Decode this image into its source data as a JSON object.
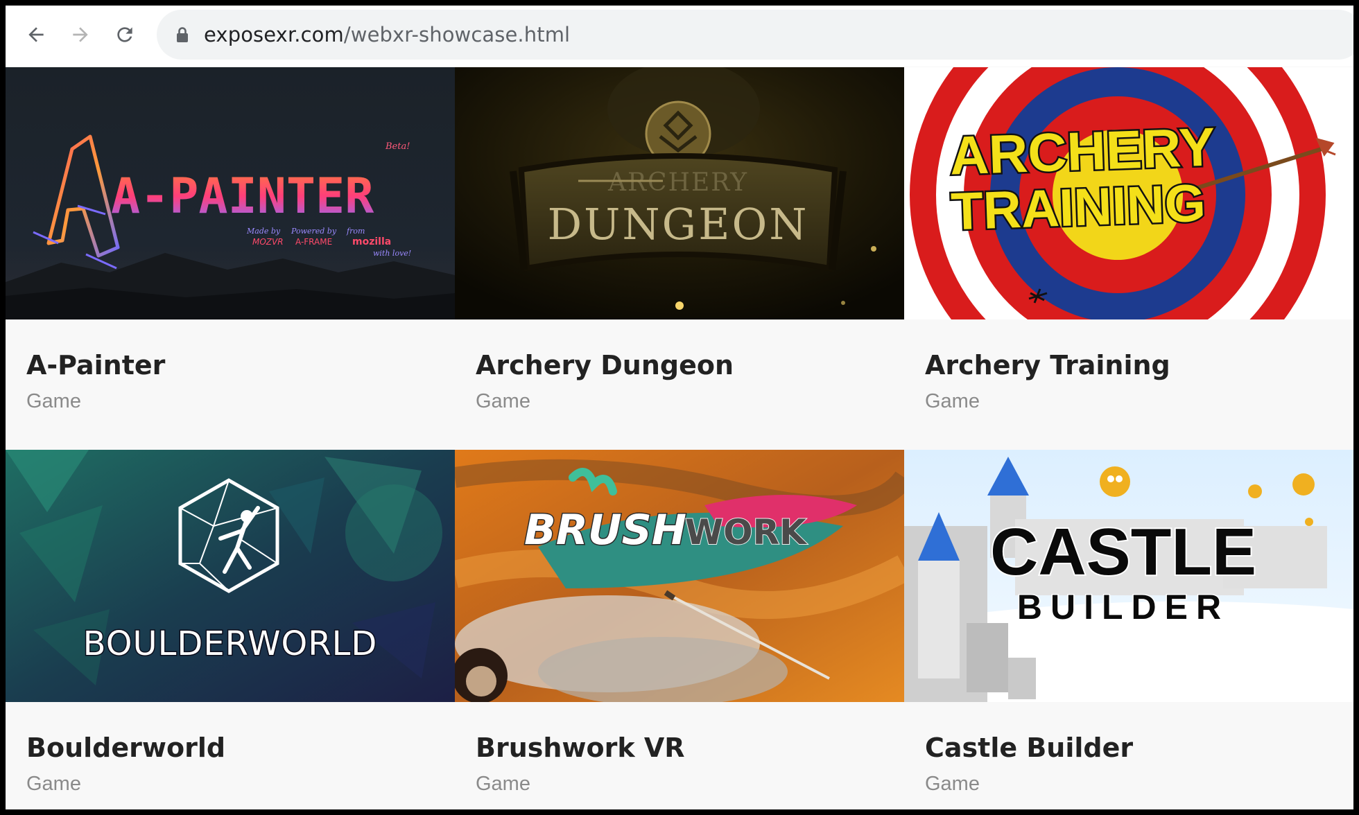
{
  "browser": {
    "url_host": "exposexr.com",
    "url_path": "/webxr-showcase.html"
  },
  "cards": [
    {
      "title": "A-Painter",
      "category": "Game",
      "thumb": {
        "logo": "A-PAINTER",
        "beta": "Beta!",
        "credit_1a": "Made by",
        "credit_1b": "MOZVR",
        "credit_2a": "Powered by",
        "credit_2b": "A-FRAME",
        "credit_3a": "from",
        "credit_3b": "mozilla",
        "credit_3c": "with love!"
      }
    },
    {
      "title": "Archery Dungeon",
      "category": "Game",
      "thumb": {
        "logo_top": "ARCHERY",
        "logo_bottom": "DUNGEON"
      }
    },
    {
      "title": "Archery Training",
      "category": "Game",
      "thumb": {
        "logo_top": "ARCHERY",
        "logo_bottom": "TRAINING"
      }
    },
    {
      "title": "Boulderworld",
      "category": "Game",
      "thumb": {
        "logo": "BOULDERWORLD"
      }
    },
    {
      "title": "Brushwork VR",
      "category": "Game",
      "thumb": {
        "logo_left": "BRUSH",
        "logo_right": "WORK"
      }
    },
    {
      "title": "Castle Builder",
      "category": "Game",
      "thumb": {
        "logo_top": "CASTLE",
        "logo_bottom": "BUILDER"
      }
    }
  ]
}
